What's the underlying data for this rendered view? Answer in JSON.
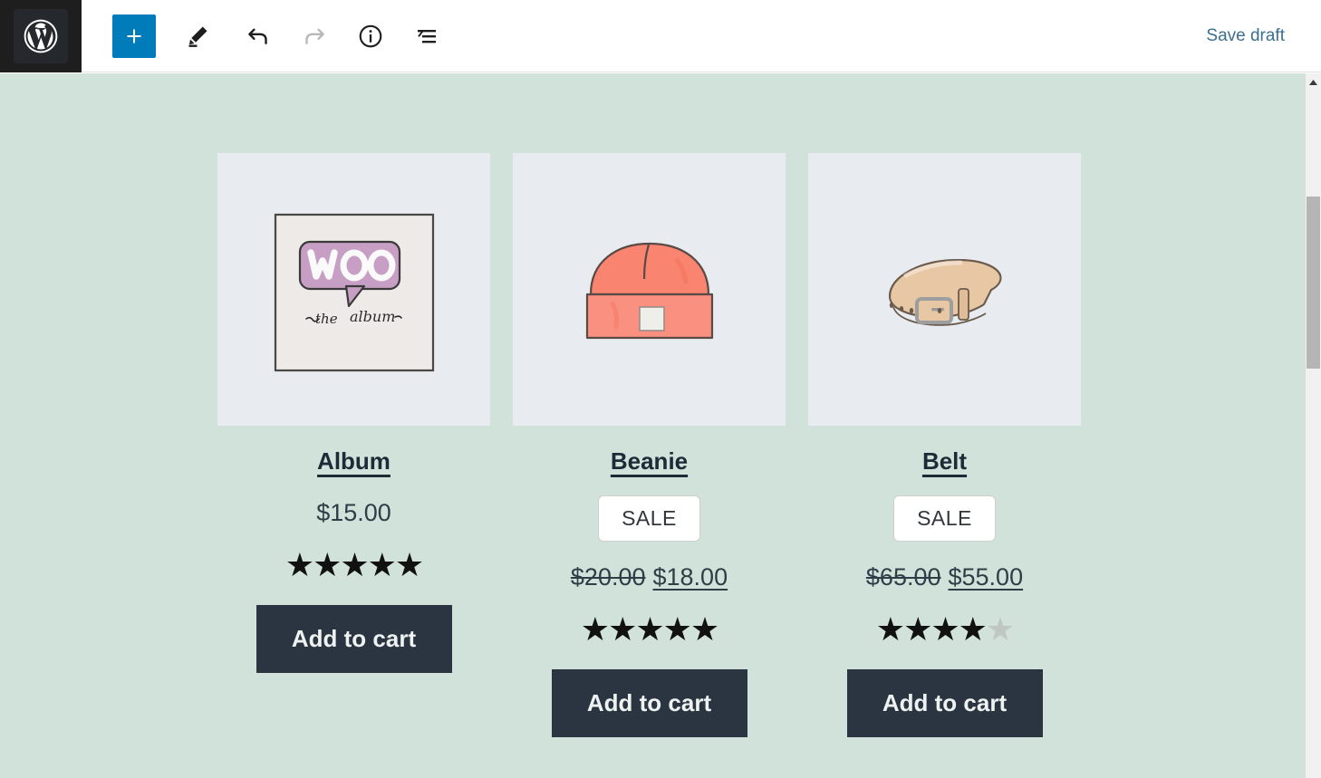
{
  "header": {
    "logo_icon": "wordpress-logo-icon",
    "tools": [
      {
        "name": "add-block-button",
        "icon": "plus-icon",
        "label": "Add block",
        "state": "enabled"
      },
      {
        "name": "edit-tool-button",
        "icon": "pencil-icon",
        "label": "Edit",
        "state": "enabled"
      },
      {
        "name": "undo-button",
        "icon": "undo-arrow-icon",
        "label": "Undo",
        "state": "enabled"
      },
      {
        "name": "redo-button",
        "icon": "redo-arrow-icon",
        "label": "Redo",
        "state": "disabled"
      },
      {
        "name": "details-button",
        "icon": "info-circle-icon",
        "label": "Details",
        "state": "enabled"
      },
      {
        "name": "list-view-button",
        "icon": "list-view-icon",
        "label": "List View",
        "state": "enabled"
      }
    ],
    "save_draft_label": "Save draft",
    "save_draft_color": "#3c6f8f",
    "accent_color": "#007cba"
  },
  "canvas": {
    "background_color": "#d1e2db",
    "image_tile_color": "#e8ecf0",
    "button_color": "#2b3542",
    "text_color": "#1d2b36"
  },
  "products": [
    {
      "name": "album",
      "title": "Album",
      "image_icon": "album-cover-woo-image",
      "image_alt_text_woo": "Woo",
      "image_alt_text_sub": "the   album",
      "on_sale": false,
      "sale_label": "",
      "price": "$15.00",
      "price_old": "",
      "price_new": "",
      "rating_filled": 5,
      "rating_total": 5,
      "add_to_cart_label": "Add to cart"
    },
    {
      "name": "beanie",
      "title": "Beanie",
      "image_icon": "beanie-hat-image",
      "on_sale": true,
      "sale_label": "SALE",
      "price": "",
      "price_old": "$20.00",
      "price_new": "$18.00",
      "rating_filled": 5,
      "rating_total": 5,
      "add_to_cart_label": "Add to cart"
    },
    {
      "name": "belt",
      "title": "Belt",
      "image_icon": "leather-belt-image",
      "on_sale": true,
      "sale_label": "SALE",
      "price": "",
      "price_old": "$65.00",
      "price_new": "$55.00",
      "rating_filled": 4,
      "rating_total": 5,
      "add_to_cart_label": "Add to cart"
    }
  ],
  "scrollbar": {
    "up_arrow_icon": "triangle-up-icon",
    "thumb_name": "scroll-thumb"
  }
}
